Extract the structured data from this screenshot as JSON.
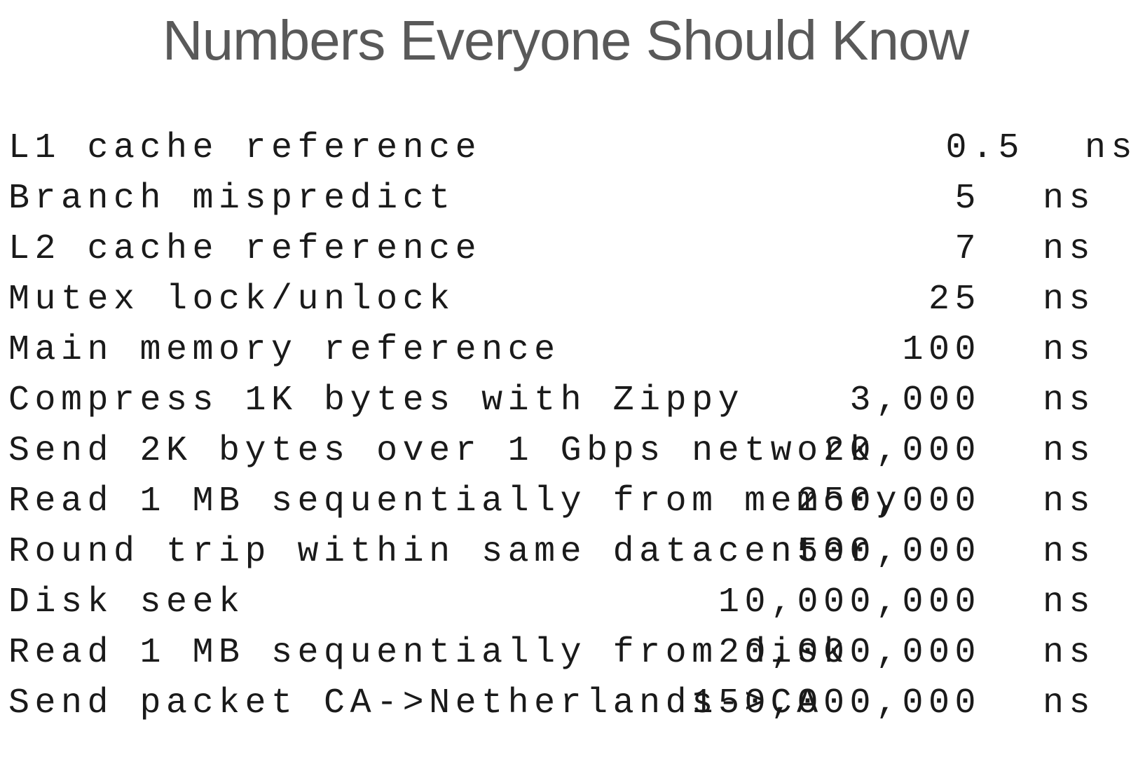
{
  "title": "Numbers Everyone Should Know",
  "rows": [
    {
      "label": "L1 cache reference",
      "value": "0.5",
      "unit": "ns"
    },
    {
      "label": "Branch mispredict",
      "value": "5",
      "unit": "ns"
    },
    {
      "label": "L2 cache reference",
      "value": "7",
      "unit": "ns"
    },
    {
      "label": "Mutex lock/unlock",
      "value": "25",
      "unit": "ns"
    },
    {
      "label": "Main memory reference",
      "value": "100",
      "unit": "ns"
    },
    {
      "label": "Compress 1K bytes with Zippy",
      "value": "3,000",
      "unit": "ns"
    },
    {
      "label": "Send 2K bytes over 1 Gbps network",
      "value": "20,000",
      "unit": "ns"
    },
    {
      "label": "Read 1 MB sequentially from memory",
      "value": "250,000",
      "unit": "ns"
    },
    {
      "label": "Round trip within same datacenter",
      "value": "500,000",
      "unit": "ns"
    },
    {
      "label": "Disk seek",
      "value": "10,000,000",
      "unit": "ns"
    },
    {
      "label": "Read 1 MB sequentially from disk",
      "value": "20,000,000",
      "unit": "ns"
    },
    {
      "label": "Send packet CA->Netherlands->CA",
      "value": "150,000,000",
      "unit": "ns"
    }
  ]
}
